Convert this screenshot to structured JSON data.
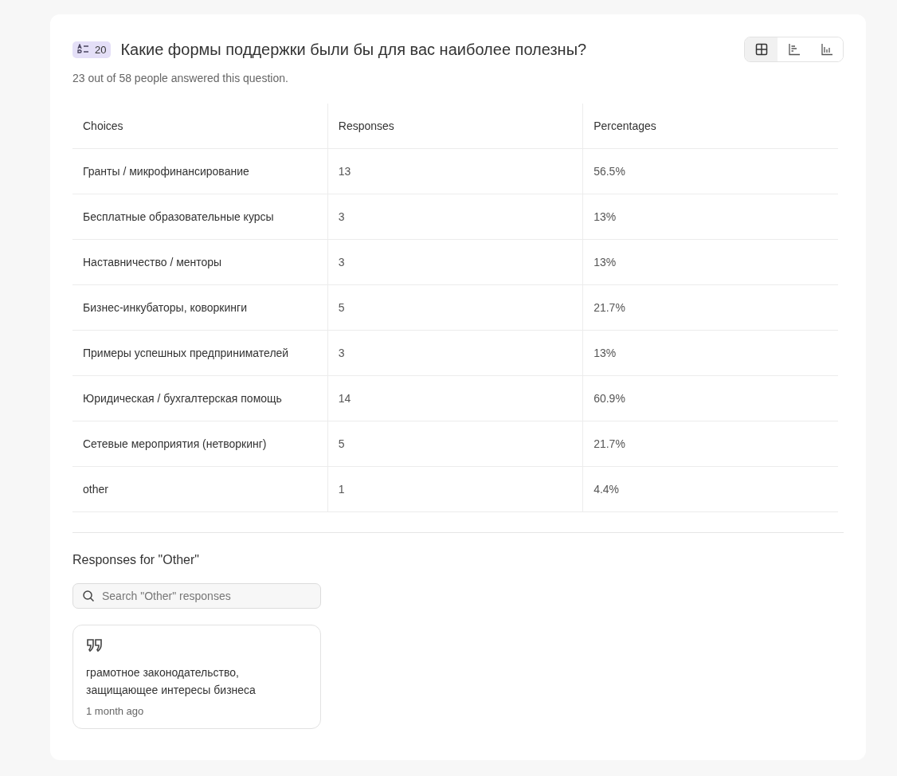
{
  "question": {
    "number": "20",
    "title": "Какие формы поддержки были бы для вас наиболее полезны?",
    "answered": "23 out of 58 people answered this question."
  },
  "view_toggle": [
    {
      "kind": "table",
      "selected": true
    },
    {
      "kind": "hbar",
      "selected": false
    },
    {
      "kind": "vbar",
      "selected": false
    }
  ],
  "table": {
    "columns": [
      "Choices",
      "Responses",
      "Percentages"
    ],
    "rows": [
      [
        "Гранты / микрофинансирование",
        "13",
        "56.5%"
      ],
      [
        "Бесплатные образовательные курсы",
        "3",
        "13%"
      ],
      [
        "Наставничество / менторы",
        "3",
        "13%"
      ],
      [
        "Бизнес-инкубаторы, коворкинги",
        "5",
        "21.7%"
      ],
      [
        "Примеры успешных предпринимателей",
        "3",
        "13%"
      ],
      [
        "Юридическая / бухгалтерская помощь",
        "14",
        "60.9%"
      ],
      [
        "Сетевые мероприятия (нетворкинг)",
        "5",
        "21.7%"
      ],
      [
        "other",
        "1",
        "4.4%"
      ]
    ]
  },
  "other": {
    "heading": "Responses for \"Other\"",
    "search": {
      "placeholder": "Search \"Other\" responses"
    },
    "responses": [
      {
        "text": "грамотное законодательство, защищающее интересы бизнеса",
        "time": "1 month ago"
      }
    ]
  }
}
